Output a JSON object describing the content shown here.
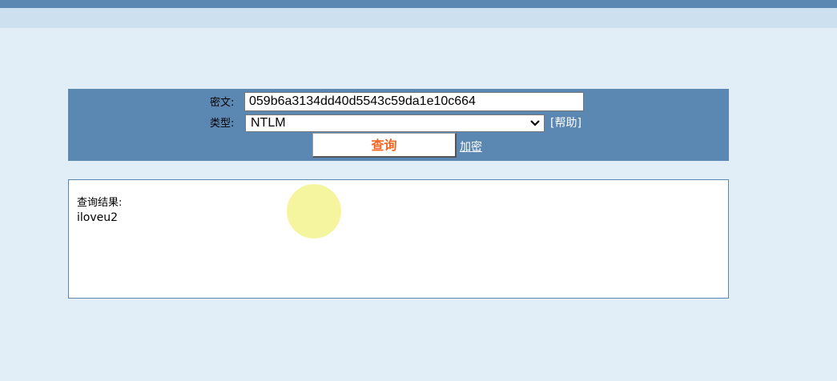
{
  "form": {
    "cipher_label": "密文:",
    "cipher_value": "059b6a3134dd40d5543c59da1e10c664",
    "type_label": "类型:",
    "type_selected": "NTLM",
    "help_link": "[帮助]",
    "query_button": "查询",
    "encrypt_link": "加密"
  },
  "result": {
    "label": "查询结果:",
    "value": "iloveu2"
  },
  "colors": {
    "header_bar": "#5b87b3",
    "sub_bar": "#cce0ef",
    "page_bg": "#e2eef7",
    "query_text": "#f26522",
    "cursor_highlight": "#f5f49a"
  }
}
